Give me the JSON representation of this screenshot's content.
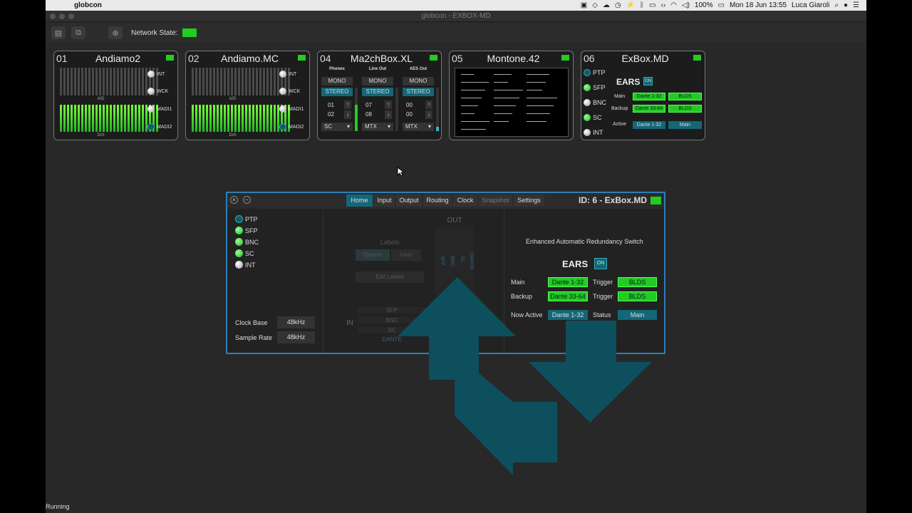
{
  "menubar": {
    "app": "globcon",
    "battery": "100%",
    "datetime": "Mon 18 Jun  13:55",
    "user": "Luca Giaroli"
  },
  "window": {
    "title": "globcon - EXBOX-MD"
  },
  "toolbar": {
    "network_label": "Network State:"
  },
  "cards": [
    {
      "num": "01",
      "name": "Andiamo2",
      "ad": "A/D",
      "da": "D/A",
      "clocks": [
        "INT",
        "WCK",
        "MADI1",
        "MADI2"
      ]
    },
    {
      "num": "02",
      "name": "Andiamo.MC",
      "ad": "A/D",
      "da": "D/A",
      "clocks": [
        "INT",
        "WCK",
        "MADI1",
        "MADI2"
      ]
    },
    {
      "num": "04",
      "name": "Ma2chBox.XL",
      "columns": [
        {
          "head": "Phones",
          "mono": "MONO",
          "stereo": "STEREO",
          "a": "01",
          "b": "02",
          "sel": "SC"
        },
        {
          "head": "Line Out",
          "mono": "MONO",
          "stereo": "STEREO",
          "a": "07",
          "b": "08",
          "sel": "MTX"
        },
        {
          "head": "AES Out",
          "mono": "MONO",
          "stereo": "STEREO",
          "a": "00",
          "b": "00",
          "sel": "MTX"
        }
      ]
    },
    {
      "num": "05",
      "name": "Montone.42"
    },
    {
      "num": "06",
      "name": "ExBox.MD",
      "sources": [
        "PTP",
        "SFP",
        "BNC",
        "SC",
        "INT"
      ],
      "ears": "EARS",
      "on": "ON",
      "main": "Main",
      "main_val": "Dante 1-32",
      "main_trig": "BLDS",
      "backup": "Backup",
      "backup_val": "Dante 33-64",
      "backup_trig": "BLDS",
      "active": "Active",
      "active_val": "Dante 1-32",
      "active_stat": "Main"
    }
  ],
  "dialog": {
    "tabs": [
      "Home",
      "Input",
      "Output",
      "Routing",
      "Clock",
      "Snapshot",
      "Settings"
    ],
    "id": "ID: 6 - ExBox.MD",
    "sources": [
      "PTP",
      "SFP",
      "BNC",
      "SC",
      "INT"
    ],
    "clock_base_label": "Clock Base",
    "clock_base": "48kHz",
    "sample_rate_label": "Sample Rate",
    "sample_rate": "48kHz",
    "labels_title": "Labels",
    "system": "System",
    "user": "User",
    "edit_labels": "Edit Labels",
    "in": "IN",
    "out": "OUT",
    "out_cols": [
      "SFP",
      "BNC",
      "SC",
      "DANTE"
    ],
    "in_rows": [
      "SFP",
      "BNC",
      "SC",
      "DANTE"
    ],
    "ears_title": "Enhanced Automatic Redundancy Switch",
    "ears": "EARS",
    "on": "ON",
    "main": "Main",
    "main_val": "Dante 1-32",
    "trigger": "Trigger",
    "main_trig": "BLDS",
    "backup": "Backup",
    "backup_val": "Dante 33-64",
    "backup_trig": "BLDS",
    "now_active": "Now Active",
    "now_val": "Dante 1-32",
    "status": "Status",
    "status_val": "Main"
  },
  "statusbar": {
    "text": "Running"
  },
  "colors": {
    "accent": "#136778",
    "led_green": "#22cc22",
    "arrow": "#0e4f5e",
    "dialog_border": "#2d7fb8"
  }
}
